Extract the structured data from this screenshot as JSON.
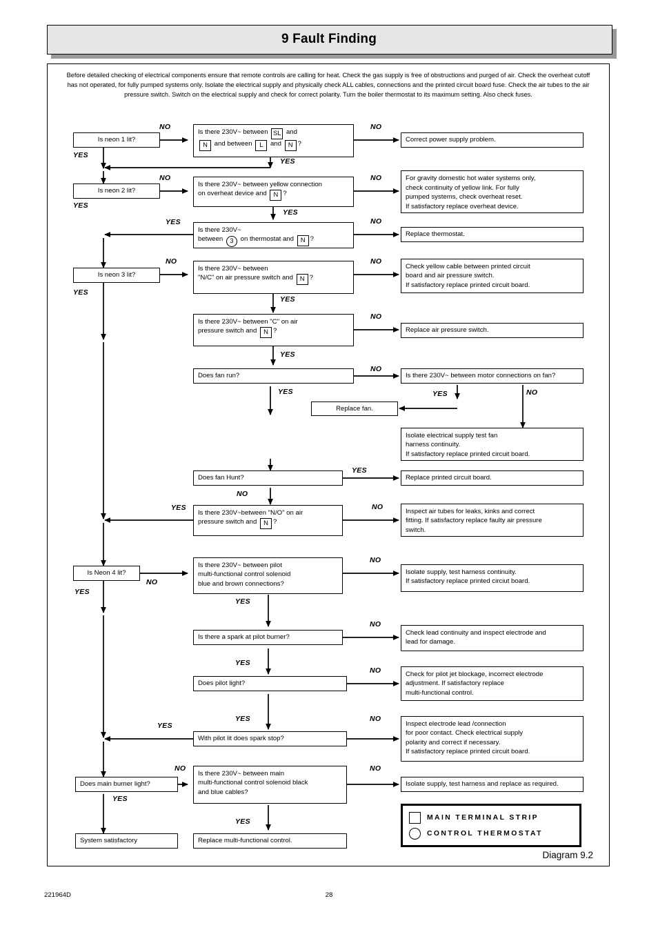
{
  "header": {
    "title": "9 Fault Finding"
  },
  "intro": "Before detailed checking of electrical components ensure that remote controls are calling for heat.  Check the gas supply is free of obstructions and purged of air.  Check the overheat cutoff has not operated,  for fully pumped systems only.  Isolate the electrical supply and physically check ALL cables, connections and the printed circuit board fuse.   Check the air tubes to the air pressure switch.  Switch on the electrical supply and check for correct polarity.  Turn the boiler thermostat to its maximum setting. Also check fuses.",
  "labels": {
    "yes": "YES",
    "no": "NO"
  },
  "nodes": {
    "neon1": "Is neon 1 lit?",
    "neon2": "Is neon 2 lit?",
    "neon3": "Is neon 3 lit?",
    "neon4": "Is Neon  4 lit?",
    "q_sl_n": {
      "l1a": "Is there 230V~ between",
      "sl": "SL",
      "l1b": "and",
      "n1": "N",
      "l2a": "and between",
      "l": "L",
      "l2b": "and",
      "n2": "N",
      "l2c": "?"
    },
    "q_overheat": {
      "l1": "Is there 230V~ between yellow connection",
      "l2a": "on overheat device and",
      "n": "N",
      "l2b": "?"
    },
    "q_thermostat": {
      "l1": "Is there 230V~",
      "l2a": "between",
      "c3": "3",
      "l2b": "on thermostat and",
      "n": "N",
      "l2c": "?"
    },
    "q_nc": {
      "l1": "Is there 230V~ between",
      "l2a": "\"N/C\"  on air pressure switch and",
      "n": "N",
      "l2b": "?"
    },
    "q_c": {
      "l1a": "Is there 230V~ between",
      "c": "\"C\"",
      "l1b": "on air",
      "l2a": "pressure switch and",
      "n": "N",
      "l2b": "?"
    },
    "q_fan_run": "Does fan run?",
    "q_fan_motor": "Is there 230V~ between motor connections on fan?",
    "q_fan_hunt": "Does fan Hunt?",
    "q_no": {
      "l1a": "Is there 230V~between",
      "no": "\"N/O\"",
      "l1b": "on  air",
      "l2a": "pressure switch and",
      "n": "N",
      "l2b": "?"
    },
    "q_pilot_solenoid": {
      "l1": "Is there 230V~ between pilot",
      "l2": "multi-functional control solenoid",
      "l3": "blue and brown connections?"
    },
    "q_spark": "Is there a spark at pilot burner?",
    "q_pilot_light": "Does pilot light?",
    "q_spark_stop": "With pilot lit does spark stop?",
    "q_main_burner": "Does main burner light?",
    "q_main_solenoid": {
      "l1": "Is there 230V~  between main",
      "l2": "multi-functional control solenoid black",
      "l3": "and blue cables?"
    }
  },
  "actions": {
    "power": "Correct power supply problem.",
    "overheat": {
      "l1": "For gravity domestic hot water systems only,",
      "l2": "check continuity of yellow link.  For fully",
      "l3": "pumped systems,  check overheat reset.",
      "l4": "If satisfactory replace overheat device."
    },
    "thermostat": "Replace thermostat.",
    "yellow_cable": {
      "l1": "Check yellow cable between printed circuit",
      "l2": "board and air pressure switch.",
      "l3": "If satisfactory replace printed circuit board."
    },
    "aps": "Replace air pressure switch.",
    "replace_fan": "Replace fan.",
    "fan_harness": {
      "l1": "Isolate electrical supply test fan",
      "l2": "harness continuity.",
      "l3": "If satisfactory replace printed circuit board."
    },
    "pcb": "Replace printed circuit board.",
    "air_tubes": {
      "l1": "Inspect air tubes for leaks, kinks and correct",
      "l2": "fitting. If satisfactory replace faulty air pressure",
      "l3": "switch."
    },
    "pilot_harness": {
      "l1": "Isolate supply, test harness continuity.",
      "l2": "If satisfactory replace printed circiut board."
    },
    "electrode_lead": {
      "l1": "Check lead continuity and inspect electrode and",
      "l2": "lead for damage."
    },
    "pilot_jet": {
      "l1": "Check for pilot jet blockage, incorrect electrode",
      "l2": "adjustment.  If satisfactory replace",
      "l3": "multi-functional control."
    },
    "electrode_connection": {
      "l1": "Inspect electrode lead /connection",
      "l2": "for poor contact.  Check electrical supply",
      "l3": "polarity and correct if necessary.",
      "l4": "If satisfactory replace printed circuit board."
    },
    "main_harness": "Isolate supply, test harness and replace as required.",
    "system_ok": "System satisfactory",
    "replace_mfc": "Replace multi-functional control."
  },
  "legend": {
    "terminal_strip": "MAIN TERMINAL STRIP",
    "control_thermostat": "CONTROL THERMOSTAT"
  },
  "diagram_number": "Diagram 9.2",
  "footer": {
    "code": "221964D",
    "page": "28"
  }
}
